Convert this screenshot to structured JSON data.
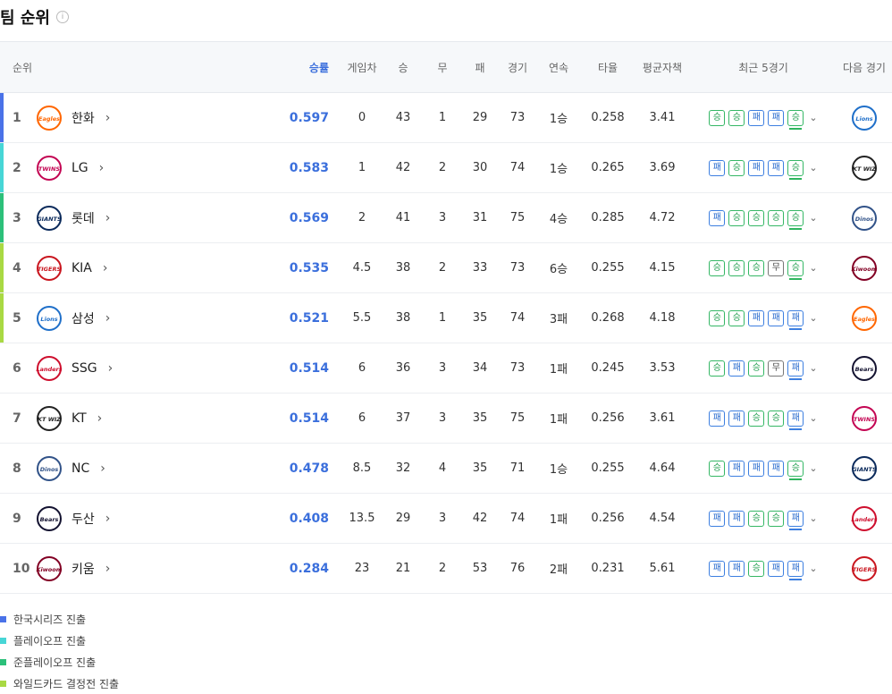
{
  "header": {
    "title": "팀 순위",
    "info_icon": "info-circle-icon"
  },
  "columns": [
    "순위",
    "승률",
    "게임차",
    "승",
    "무",
    "패",
    "경기",
    "연속",
    "타율",
    "평균자책",
    "최근 5경기",
    "다음 경기"
  ],
  "teams": [
    {
      "rank": "1",
      "name": "한화",
      "logo_text": "Eagles",
      "logo_color": "#ff6600",
      "pct": "0.597",
      "gb": "0",
      "w": "43",
      "d": "1",
      "l": "29",
      "g": "73",
      "streak": "1승",
      "avg": "0.258",
      "era": "3.41",
      "recent": [
        "승",
        "승",
        "패",
        "패",
        "승"
      ],
      "next": "Lions",
      "next_color": "#1f6fc9",
      "bar_color": "#4a72e8"
    },
    {
      "rank": "2",
      "name": "LG",
      "logo_text": "TWINS",
      "logo_color": "#c30452",
      "pct": "0.583",
      "gb": "1",
      "w": "42",
      "d": "2",
      "l": "30",
      "g": "74",
      "streak": "1승",
      "avg": "0.265",
      "era": "3.69",
      "recent": [
        "패",
        "승",
        "패",
        "패",
        "승"
      ],
      "next": "KT WIZ",
      "next_color": "#222222",
      "bar_color": "#47d6d6"
    },
    {
      "rank": "3",
      "name": "롯데",
      "logo_text": "GIANTS",
      "logo_color": "#0b2a5b",
      "pct": "0.569",
      "gb": "2",
      "w": "41",
      "d": "3",
      "l": "31",
      "g": "75",
      "streak": "4승",
      "avg": "0.285",
      "era": "4.72",
      "recent": [
        "패",
        "승",
        "승",
        "승",
        "승"
      ],
      "next": "Dinos",
      "next_color": "#315288",
      "bar_color": "#2cc07a"
    },
    {
      "rank": "4",
      "name": "KIA",
      "logo_text": "TIGERS",
      "logo_color": "#c9151e",
      "pct": "0.535",
      "gb": "4.5",
      "w": "38",
      "d": "2",
      "l": "33",
      "g": "73",
      "streak": "6승",
      "avg": "0.255",
      "era": "4.15",
      "recent": [
        "승",
        "승",
        "승",
        "무",
        "승"
      ],
      "next": "Kiwoom",
      "next_color": "#820024",
      "bar_color": "#a9d943"
    },
    {
      "rank": "5",
      "name": "삼성",
      "logo_text": "Lions",
      "logo_color": "#1f6fc9",
      "pct": "0.521",
      "gb": "5.5",
      "w": "38",
      "d": "1",
      "l": "35",
      "g": "74",
      "streak": "3패",
      "avg": "0.268",
      "era": "4.18",
      "recent": [
        "승",
        "승",
        "패",
        "패",
        "패"
      ],
      "next": "Eagles",
      "next_color": "#ff6600",
      "bar_color": "#a9d943"
    },
    {
      "rank": "6",
      "name": "SSG",
      "logo_text": "Landers",
      "logo_color": "#ce0e2d",
      "pct": "0.514",
      "gb": "6",
      "w": "36",
      "d": "3",
      "l": "34",
      "g": "73",
      "streak": "1패",
      "avg": "0.245",
      "era": "3.53",
      "recent": [
        "승",
        "패",
        "승",
        "무",
        "패"
      ],
      "next": "Bears",
      "next_color": "#131230",
      "bar_color": ""
    },
    {
      "rank": "7",
      "name": "KT",
      "logo_text": "KT WIZ",
      "logo_color": "#222222",
      "pct": "0.514",
      "gb": "6",
      "w": "37",
      "d": "3",
      "l": "35",
      "g": "75",
      "streak": "1패",
      "avg": "0.256",
      "era": "3.61",
      "recent": [
        "패",
        "패",
        "승",
        "승",
        "패"
      ],
      "next": "TWINS",
      "next_color": "#c30452",
      "bar_color": ""
    },
    {
      "rank": "8",
      "name": "NC",
      "logo_text": "Dinos",
      "logo_color": "#315288",
      "pct": "0.478",
      "gb": "8.5",
      "w": "32",
      "d": "4",
      "l": "35",
      "g": "71",
      "streak": "1승",
      "avg": "0.255",
      "era": "4.64",
      "recent": [
        "승",
        "패",
        "패",
        "패",
        "승"
      ],
      "next": "GIANTS",
      "next_color": "#0b2a5b",
      "bar_color": ""
    },
    {
      "rank": "9",
      "name": "두산",
      "logo_text": "Bears",
      "logo_color": "#131230",
      "pct": "0.408",
      "gb": "13.5",
      "w": "29",
      "d": "3",
      "l": "42",
      "g": "74",
      "streak": "1패",
      "avg": "0.256",
      "era": "4.54",
      "recent": [
        "패",
        "패",
        "승",
        "승",
        "패"
      ],
      "next": "Landers",
      "next_color": "#ce0e2d",
      "bar_color": ""
    },
    {
      "rank": "10",
      "name": "키움",
      "logo_text": "Kiwoom",
      "logo_color": "#820024",
      "pct": "0.284",
      "gb": "23",
      "w": "21",
      "d": "2",
      "l": "53",
      "g": "76",
      "streak": "2패",
      "avg": "0.231",
      "era": "5.61",
      "recent": [
        "패",
        "패",
        "승",
        "패",
        "패"
      ],
      "next": "TIGERS",
      "next_color": "#c9151e",
      "bar_color": ""
    }
  ],
  "legend": [
    {
      "label": "한국시리즈 진출",
      "color": "#4a72e8"
    },
    {
      "label": "플레이오프 진출",
      "color": "#47d6d6"
    },
    {
      "label": "준플레이오프 진출",
      "color": "#2cc07a"
    },
    {
      "label": "와일드카드 결정전 진출",
      "color": "#a9d943"
    }
  ]
}
